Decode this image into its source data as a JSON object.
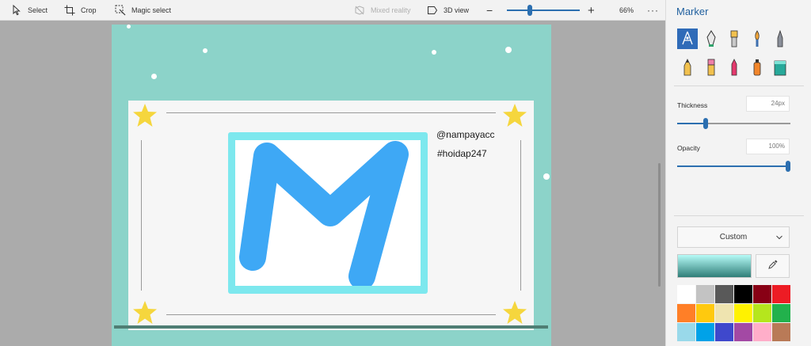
{
  "toolbar": {
    "select_label": "Select",
    "crop_label": "Crop",
    "magic_select_label": "Magic select",
    "mixed_reality_label": "Mixed reality",
    "view_3d_label": "3D view",
    "zoom_value": "66%",
    "zoom_slider_position": 0.3
  },
  "canvas": {
    "colors": {
      "background": "#8cd3c9",
      "card": "#f6f6f6",
      "frame": "#7de8ee",
      "letter": "#3ea8f5",
      "star": "#f5d63d"
    },
    "handle_text": "@nampayacc",
    "hashtag_text": "#hoidap247"
  },
  "panel": {
    "title": "Marker",
    "brushes": [
      {
        "name": "marker-brush-icon",
        "selected": true
      },
      {
        "name": "calligraphy-pen-icon",
        "selected": false
      },
      {
        "name": "oil-brush-icon",
        "selected": false
      },
      {
        "name": "watercolor-icon",
        "selected": false
      },
      {
        "name": "pixel-pen-icon",
        "selected": false
      },
      {
        "name": "pencil-icon",
        "selected": false
      },
      {
        "name": "eraser-icon",
        "selected": false
      },
      {
        "name": "crayon-icon",
        "selected": false
      },
      {
        "name": "spray-can-icon",
        "selected": false
      },
      {
        "name": "fill-bucket-icon",
        "selected": false
      }
    ],
    "thickness": {
      "label": "Thickness",
      "value": "24px",
      "slider_fraction": 0.24
    },
    "opacity": {
      "label": "Opacity",
      "value": "100%",
      "slider_fraction": 1.0
    },
    "color_dropdown": "Custom",
    "current_color": {
      "from": "#b6fbf7",
      "to": "#2f7e78"
    },
    "palette": [
      "#ffffff",
      "#c3c3c3",
      "#595959",
      "#000000",
      "#880015",
      "#ed1c24",
      "#ff7f27",
      "#ffc90e",
      "#efe4b0",
      "#fff200",
      "#b5e61d",
      "#22b14c",
      "#99d9ea",
      "#00a2e8",
      "#3f48cc",
      "#a349a4",
      "#ffaec9",
      "#b97a57"
    ]
  }
}
